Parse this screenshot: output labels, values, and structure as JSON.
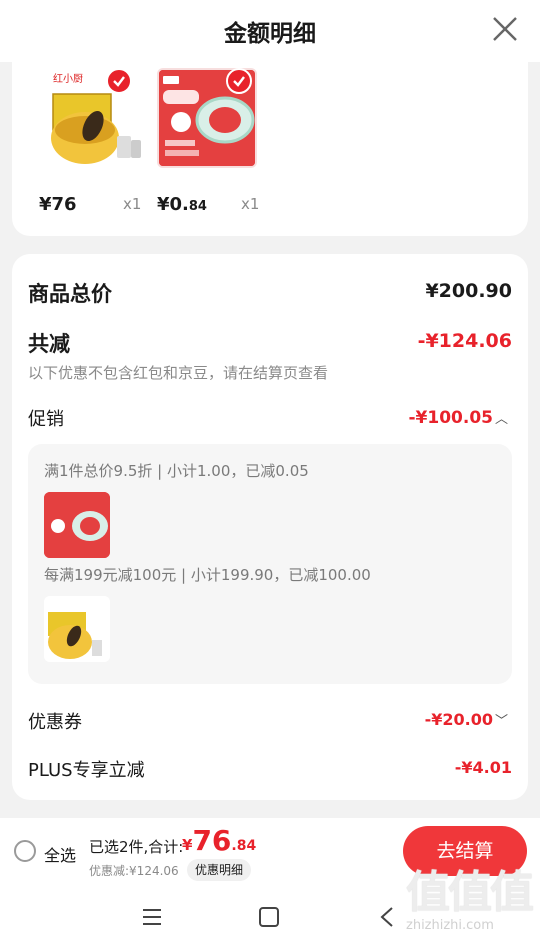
{
  "header": {
    "title": "金额明细",
    "close_icon": "close-icon"
  },
  "products": [
    {
      "price_int": "¥76",
      "price_dec": "",
      "qty": "x1",
      "brand_text": "红小厨",
      "checked": true
    },
    {
      "price_int": "¥0.",
      "price_dec": "84",
      "qty": "x1",
      "checked": true
    }
  ],
  "summary": {
    "goods_total_label": "商品总价",
    "goods_total_value": "¥200.90",
    "total_reduce_label": "共减",
    "total_reduce_value": "-¥124.06",
    "note": "以下优惠不包含红包和京豆，请在结算页查看",
    "promo_label": "促销",
    "promo_value": "-¥100.05",
    "promo_lines": [
      "满1件总价9.5折 | 小计1.00，已减0.05",
      "每满199元减100元 | 小计199.90，已减100.00"
    ],
    "coupon_label": "优惠券",
    "coupon_value": "-¥20.00",
    "plus_label": "PLUS专享立减",
    "plus_value": "-¥4.01"
  },
  "bottom_bar": {
    "select_all": "全选",
    "selected_text": "已选2件,合计:",
    "total_yen": "¥",
    "total_int": "76",
    "total_dec": ".84",
    "discount_text": "优惠减:¥124.06",
    "detail_button": "优惠明细",
    "checkout_button": "去结算"
  },
  "watermark": {
    "big": "值值值",
    "small": "zhizhizhi.com"
  },
  "colors": {
    "accent": "#e8222b",
    "checkout_bg": "#f0373a"
  }
}
